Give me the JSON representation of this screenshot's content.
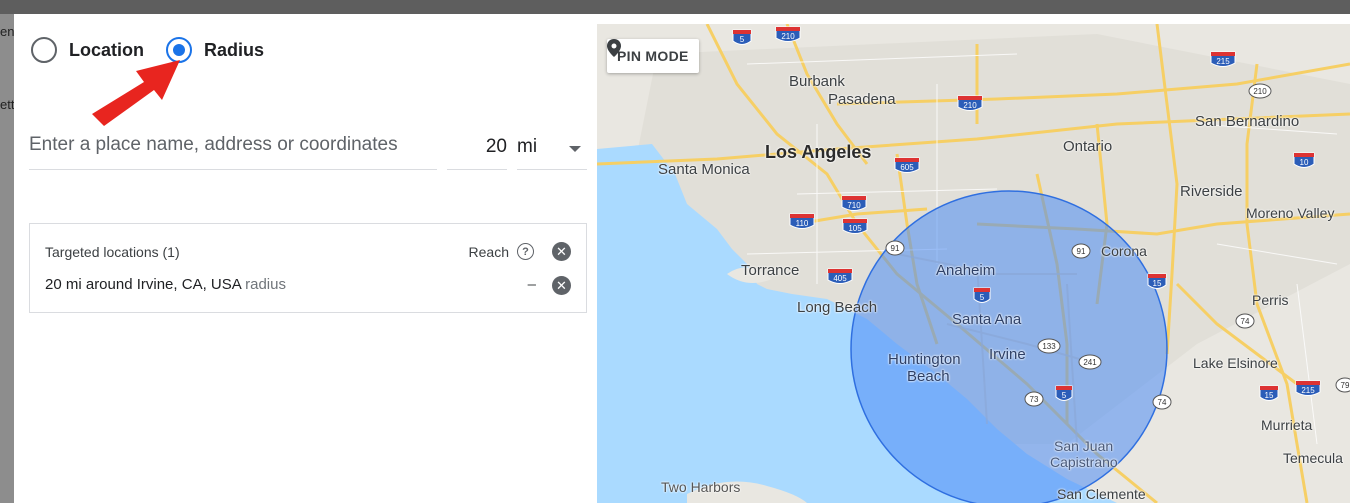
{
  "backdrop": {
    "fragments": [
      "en",
      "etti"
    ]
  },
  "mode": {
    "options": [
      {
        "label": "Location",
        "checked": false
      },
      {
        "label": "Radius",
        "checked": true
      }
    ]
  },
  "search": {
    "placeholder": "Enter a place name, address or coordinates"
  },
  "radius": {
    "value": "20",
    "unit": "mi"
  },
  "targets": {
    "header": "Targeted locations (1)",
    "reach_label": "Reach",
    "help_glyph": "?",
    "item_text": "20 mi around Irvine, CA, USA",
    "item_type": "radius",
    "item_reach": "–"
  },
  "map": {
    "pin_mode_label": "PIN MODE",
    "places": {
      "burbank": "Burbank",
      "pasadena": "Pasadena",
      "los_angeles": "Los Angeles",
      "santa_monica": "Santa Monica",
      "ontario": "Ontario",
      "san_bernardino": "San Bernardino",
      "riverside": "Riverside",
      "moreno_valley": "Moreno Valley",
      "corona": "Corona",
      "torrance": "Torrance",
      "anaheim": "Anaheim",
      "long_beach": "Long Beach",
      "santa_ana": "Santa Ana",
      "perris": "Perris",
      "irvine": "Irvine",
      "huntington": "Huntington",
      "beach": "Beach",
      "lake_elsinore": "Lake Elsinore",
      "murrieta": "Murrieta",
      "san_juan": "San Juan",
      "capistrano": "Capistrano",
      "temecula": "Temecula",
      "two_harbors": "Two Harbors",
      "san_clemente": "San Clemente"
    },
    "shields": [
      "5",
      "210",
      "215",
      "210",
      "210",
      "605",
      "10",
      "710",
      "110",
      "105",
      "91",
      "91",
      "405",
      "5",
      "15",
      "133",
      "241",
      "74",
      "73",
      "5",
      "74",
      "15",
      "215",
      "79"
    ],
    "colors": {
      "water": "#aadaff",
      "land": "#e8e6e0",
      "radius_fill": "#4d8cf5",
      "radius_stroke": "#2f6fe0",
      "highway": "#f6cf65"
    }
  }
}
